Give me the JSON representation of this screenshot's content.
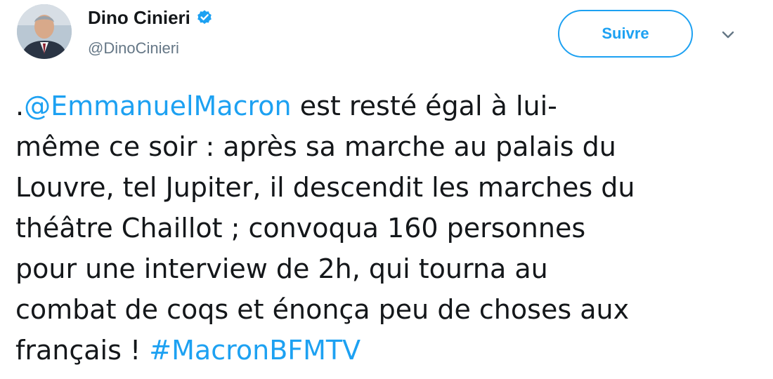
{
  "author": {
    "display_name": "Dino Cinieri",
    "handle": "@DinoCinieri",
    "verified_icon": "verified-badge-icon"
  },
  "actions": {
    "follow_label": "Suivre",
    "more_icon": "chevron-down-icon"
  },
  "tweet": {
    "prefix": ".",
    "mention": "@EmmanuelMacron",
    "body": " est resté égal à lui-\nmême ce soir : après sa marche au palais du\nLouvre, tel Jupiter, il descendit les marches du\nthéâtre Chaillot ; convoqua 160 personnes\npour une interview de 2h, qui tourna au\ncombat de coqs et énonça peu de choses aux\nfrançais ! ",
    "hashtag": "#MacronBFMTV"
  },
  "colors": {
    "link": "#1da1f2",
    "text": "#14171a",
    "secondary": "#657786",
    "background": "#ffffff"
  }
}
